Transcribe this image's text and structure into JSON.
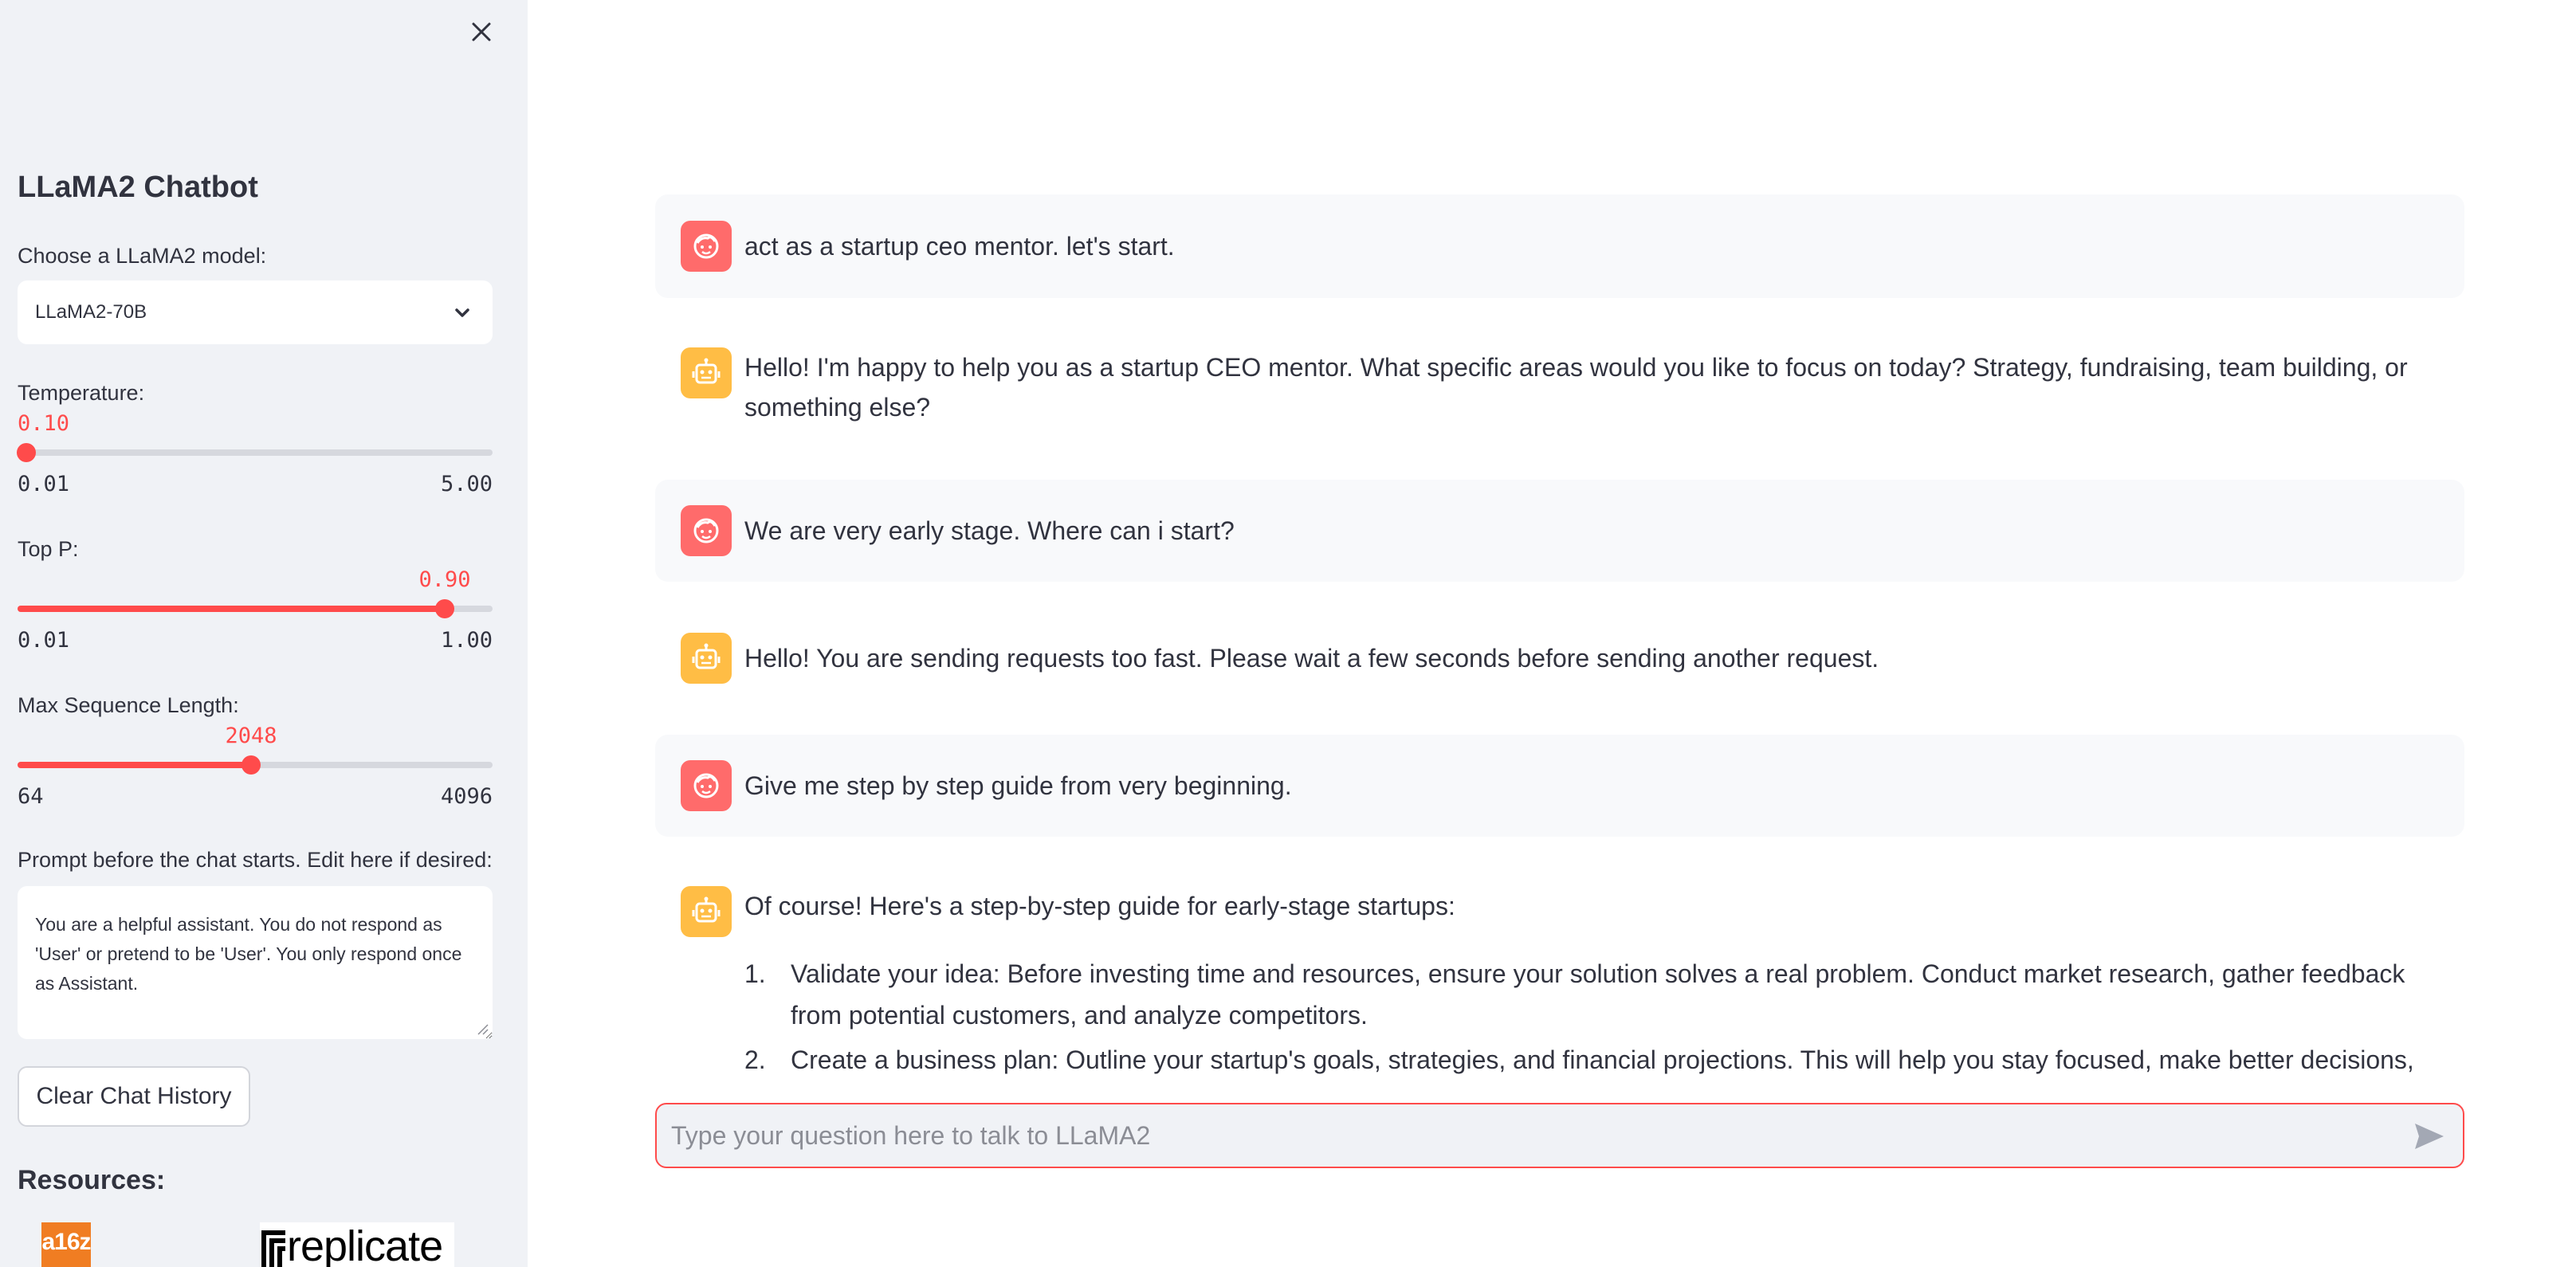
{
  "sidebar": {
    "title": "LLaMA2 Chatbot",
    "model": {
      "label": "Choose a LLaMA2 model:",
      "selected": "LLaMA2-70B"
    },
    "temperature": {
      "label": "Temperature:",
      "value": "0.10",
      "min": "0.01",
      "max": "5.00",
      "fraction": 0.018
    },
    "top_p": {
      "label": "Top P:",
      "value": "0.90",
      "min": "0.01",
      "max": "1.00",
      "fraction": 0.899
    },
    "max_length": {
      "label": "Max Sequence Length:",
      "value": "2048",
      "min": "64",
      "max": "4096",
      "fraction": 0.492
    },
    "prompt": {
      "label": "Prompt before the chat starts. Edit here if desired:",
      "value": "You are a helpful assistant. You do not respond as 'User' or pretend to be 'User'. You only respond once as Assistant."
    },
    "clear_button": "Clear Chat History",
    "resources_title": "Resources:",
    "logos": {
      "a16z": "a16z",
      "replicate": "replicate"
    }
  },
  "messages": [
    {
      "role": "user",
      "text": "act as a startup ceo mentor. let's start."
    },
    {
      "role": "assistant",
      "text": "Hello! I'm happy to help you as a startup CEO mentor. What specific areas would you like to focus on today? Strategy, fundraising, team building, or something else?"
    },
    {
      "role": "user",
      "text": "We are very early stage. Where can i start?"
    },
    {
      "role": "assistant",
      "text": "Hello! You are sending requests too fast. Please wait a few seconds before sending another request."
    },
    {
      "role": "user",
      "text": "Give me step by step guide from very beginning."
    },
    {
      "role": "assistant",
      "text": "Of course! Here's a step-by-step guide for early-stage startups:",
      "list": [
        {
          "num": "1.",
          "text": "Validate your idea: Before investing time and resources, ensure your solution solves a real problem. Conduct market research, gather feedback from potential customers, and analyze competitors."
        },
        {
          "num": "2.",
          "text": "Create a business plan: Outline your startup's goals, strategies, and financial projections. This will help you stay focused, make better decisions, and"
        }
      ]
    }
  ],
  "chat_input": {
    "placeholder": "Type your question here to talk to LLaMA2"
  },
  "colors": {
    "accent": "#ff4b4b",
    "sidebar_bg": "#f0f2f6",
    "user_avatar": "#ff6b6b",
    "bot_avatar": "#ffbd45"
  },
  "icons": {
    "close": "close-icon",
    "chevron": "chevron-down-icon",
    "user_avatar": "user-face-icon",
    "bot_avatar": "robot-icon",
    "send": "send-icon"
  }
}
